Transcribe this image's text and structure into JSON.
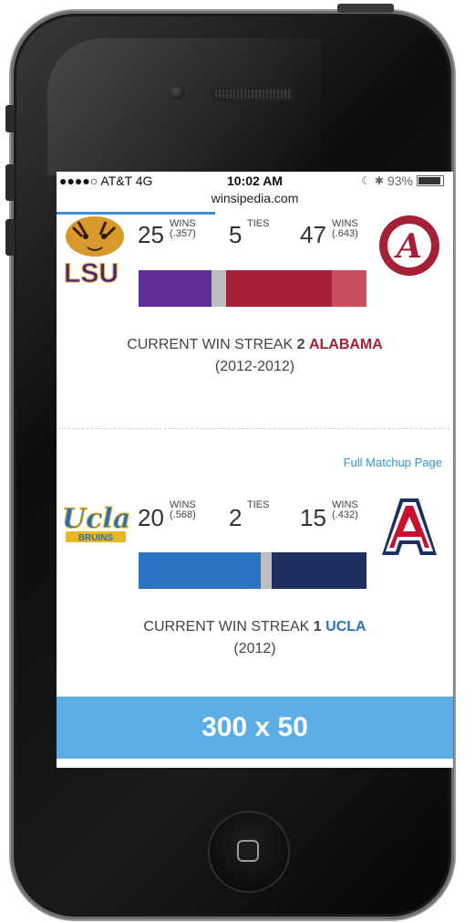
{
  "status": {
    "carrier": "●●●●○ AT&T  4G",
    "time": "10:02 AM",
    "battery": "93%",
    "url": "winsipedia.com"
  },
  "matchups": [
    {
      "left_team": "LSU",
      "right_team": "ALABAMA",
      "left_wins": "25",
      "left_wins_label": "WINS",
      "left_pct": "(.357)",
      "ties": "5",
      "ties_label": "TIES",
      "right_wins": "47",
      "right_wins_label": "WINS",
      "right_pct": "(.643)",
      "left_color": "#5d2f94",
      "right_color": "#a51f36",
      "streak_prefix": "CURRENT WIN STREAK",
      "streak_count": "2",
      "streak_team": "ALABAMA",
      "streak_team_color": "#a51f36",
      "streak_dates": "(2012-2012)"
    },
    {
      "left_team": "UCLA",
      "right_team": "Arizona",
      "left_wins": "20",
      "left_wins_label": "WINS",
      "left_pct": "(.568)",
      "ties": "2",
      "ties_label": "TIES",
      "right_wins": "15",
      "right_wins_label": "WINS",
      "right_pct": "(.432)",
      "left_color": "#2a73c2",
      "right_color": "#1c2f5e",
      "streak_prefix": "CURRENT WIN STREAK",
      "streak_count": "1",
      "streak_team": "UCLA",
      "streak_team_color": "#2a73c2",
      "streak_dates": "(2012)",
      "full_link": "Full Matchup Page"
    }
  ],
  "ad": {
    "label": "300 x 50",
    "color": "#5aaee3"
  },
  "icons": [
    "lsu-logo",
    "alabama-logo",
    "ucla-logo",
    "arizona-logo",
    "bluetooth-icon",
    "battery-icon",
    "home-icon"
  ]
}
